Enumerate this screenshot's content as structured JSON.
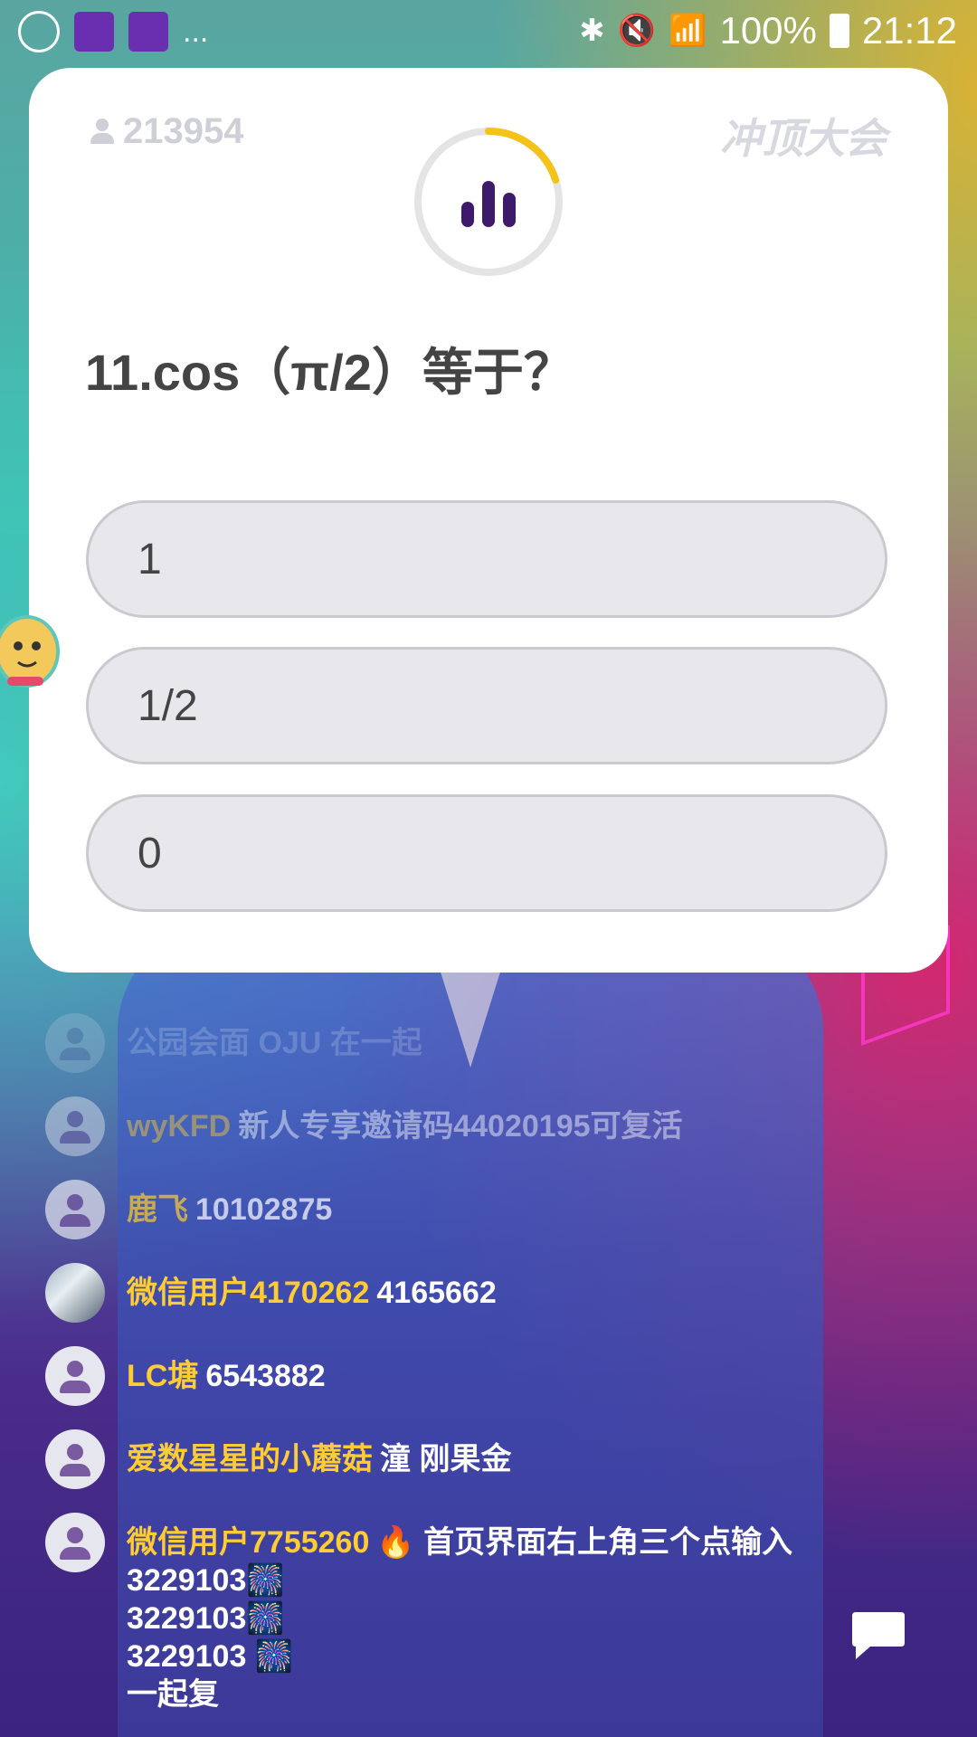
{
  "status_bar": {
    "battery": "100%",
    "time": "21:12",
    "overflow": "..."
  },
  "quiz": {
    "players": "213954",
    "logo": "冲顶大会",
    "question": "11.cos（π/2）等于？",
    "options": [
      "1",
      "1/2",
      "0"
    ],
    "timer_fraction": 0.2,
    "timer_color": "#f5c21a"
  },
  "comments": [
    {
      "name": "",
      "message": "公园会面 OJU 在一起"
    },
    {
      "name": "wyKFD",
      "message": "新人专享邀请码44020195可复活"
    },
    {
      "name": "鹿飞",
      "message": "10102875"
    },
    {
      "name": "微信用户4170262",
      "message": "4165662"
    },
    {
      "name": "LC塘",
      "message": "6543882"
    },
    {
      "name": "爱数星星的小蘑菇",
      "message": "潼 刚果金"
    },
    {
      "name": "微信用户7755260",
      "message": "🔥 首页界面右上角三个点输入"
    },
    {
      "line1": "3229103🎆",
      "line2": "3229103🎆",
      "line3": "3229103 🎆",
      "line4": "一起复"
    }
  ],
  "colors": {
    "name_color": "#ffcc33",
    "card_bg": "#ffffff",
    "option_bg": "#e8e8ec"
  }
}
